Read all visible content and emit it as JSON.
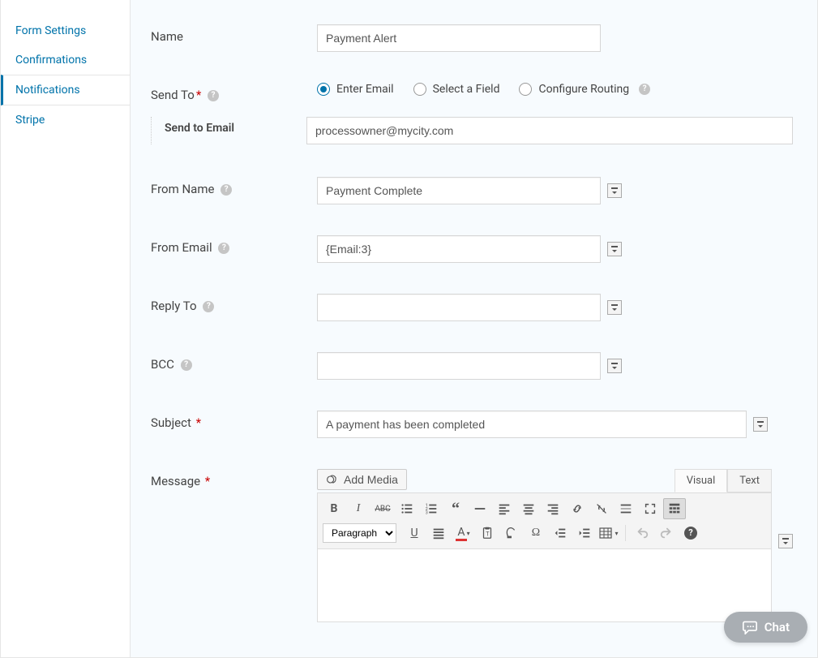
{
  "sidebar": {
    "items": [
      {
        "label": "Form Settings"
      },
      {
        "label": "Confirmations"
      },
      {
        "label": "Notifications"
      },
      {
        "label": "Stripe"
      }
    ],
    "active_index": 2
  },
  "form": {
    "name_label": "Name",
    "name_value": "Payment Alert",
    "sendto_label": "Send To",
    "sendto_options": {
      "enter_email": "Enter Email",
      "select_field": "Select a Field",
      "configure_routing": "Configure Routing"
    },
    "send_to_email_label": "Send to Email",
    "send_to_email_value": "processowner@mycity.com",
    "from_name_label": "From Name",
    "from_name_value": "Payment Complete",
    "from_email_label": "From Email",
    "from_email_value": "{Email:3}",
    "reply_to_label": "Reply To",
    "reply_to_value": "",
    "bcc_label": "BCC",
    "bcc_value": "",
    "subject_label": "Subject",
    "subject_value": "A payment has been completed",
    "message_label": "Message"
  },
  "editor": {
    "add_media_label": "Add Media",
    "tab_visual": "Visual",
    "tab_text": "Text",
    "format_select": "Paragraph"
  },
  "chat": {
    "label": "Chat"
  }
}
